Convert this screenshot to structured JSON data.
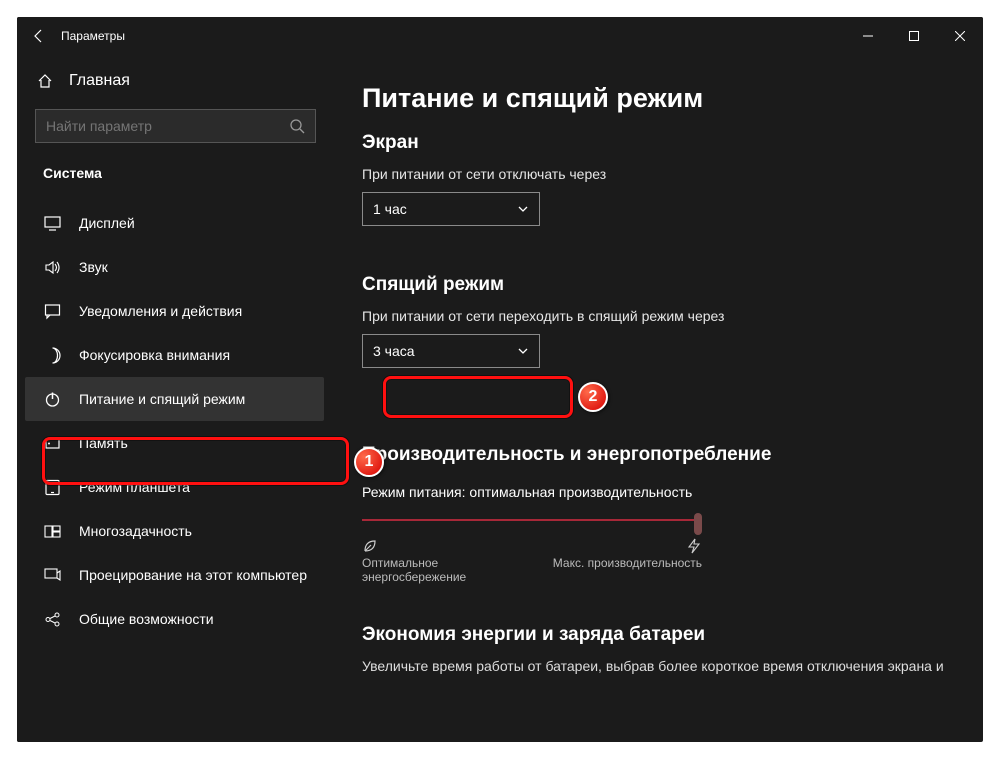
{
  "titlebar": {
    "title": "Параметры"
  },
  "sidebar": {
    "home": "Главная",
    "search_placeholder": "Найти параметр",
    "section": "Система",
    "items": [
      {
        "icon": "display-icon",
        "label": "Дисплей"
      },
      {
        "icon": "sound-icon",
        "label": "Звук"
      },
      {
        "icon": "notify-icon",
        "label": "Уведомления и действия"
      },
      {
        "icon": "focus-icon",
        "label": "Фокусировка внимания"
      },
      {
        "icon": "power-icon",
        "label": "Питание и спящий режим"
      },
      {
        "icon": "storage-icon",
        "label": "Память"
      },
      {
        "icon": "tablet-icon",
        "label": "Режим планшета"
      },
      {
        "icon": "multi-icon",
        "label": "Многозадачность"
      },
      {
        "icon": "project-icon",
        "label": "Проецирование на этот компьютер"
      },
      {
        "icon": "shared-icon",
        "label": "Общие возможности"
      }
    ]
  },
  "content": {
    "h1": "Питание и спящий режим",
    "screen": {
      "heading": "Экран",
      "label": "При питании от сети отключать через",
      "value": "1 час"
    },
    "sleep": {
      "heading": "Спящий режим",
      "label": "При питании от сети переходить в спящий режим через",
      "value": "3 часа"
    },
    "perf": {
      "heading": "Производительность и энергопотребление",
      "mode": "Режим питания: оптимальная производительность",
      "left": "Оптимальное энергосбережение",
      "right": "Макс. производительность"
    },
    "battery": {
      "heading": "Экономия энергии и заряда батареи",
      "text": "Увеличьте время работы от батареи, выбрав более короткое время отключения экрана и"
    }
  },
  "annotations": {
    "b1": "1",
    "b2": "2"
  }
}
